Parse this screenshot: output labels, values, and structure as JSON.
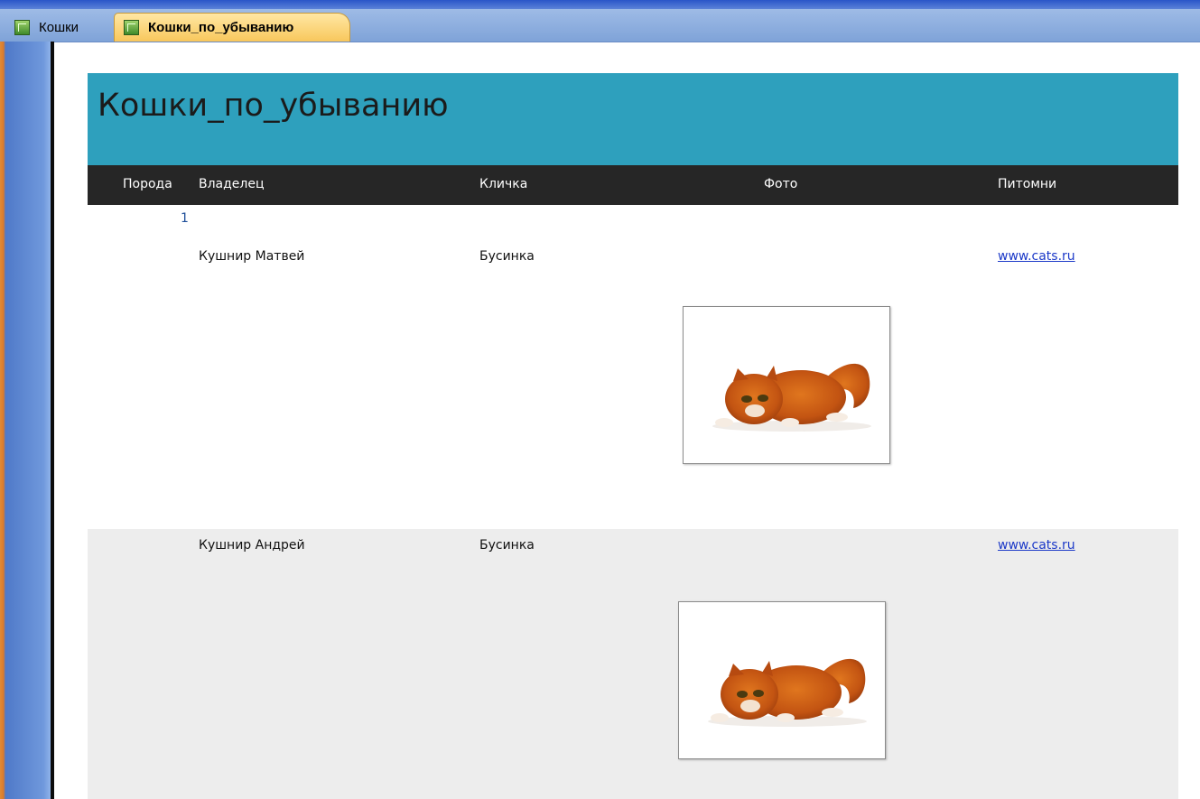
{
  "tabs": [
    {
      "label": "Кошки",
      "active": false
    },
    {
      "label": "Кошки_по_убыванию",
      "active": true
    }
  ],
  "report": {
    "title": "Кошки_по_убыванию",
    "columns": {
      "breed": "Порода",
      "owner": "Владелец",
      "name": "Кличка",
      "photo": "Фото",
      "kennel": "Питомни"
    },
    "group_value": "1",
    "records": [
      {
        "owner": "Кушнир Матвей",
        "name": "Бусинка",
        "photo": "orange-kitten-photo",
        "kennel_link": "www.cats.ru"
      },
      {
        "owner": "Кушнир Андрей",
        "name": "Бусинка",
        "photo": "orange-kitten-photo",
        "kennel_link": "www.cats.ru"
      }
    ]
  },
  "colors": {
    "header_band": "#2ea0bd",
    "column_header_bg": "#262626",
    "active_tab": "#f8c75c",
    "alt_row": "#ededed",
    "link": "#1c39c8"
  }
}
